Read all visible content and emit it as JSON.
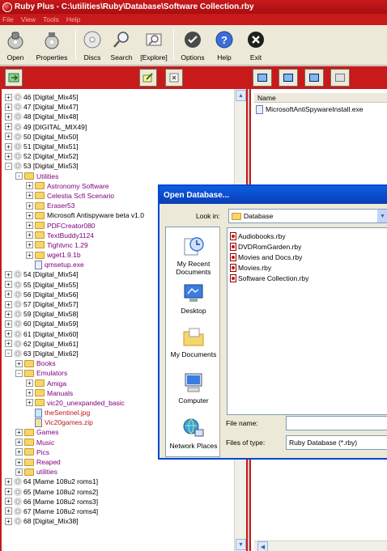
{
  "window": {
    "title": "Ruby Plus - C:\\utilities\\Ruby\\Database\\Software Collection.rby"
  },
  "menu": [
    "File",
    "View",
    "Tools",
    "Help"
  ],
  "toolbar": {
    "buttons": [
      {
        "label": "Open",
        "icon": "open-disc-icon"
      },
      {
        "label": "Properties",
        "icon": "properties-icon"
      },
      {
        "label": "Discs",
        "icon": "disc-icon"
      },
      {
        "label": "Search",
        "icon": "search-icon"
      },
      {
        "label": "[Explore]",
        "icon": "explore-icon"
      },
      {
        "label": "Options",
        "icon": "options-check-icon"
      },
      {
        "label": "Help",
        "icon": "help-icon"
      },
      {
        "label": "Exit",
        "icon": "exit-icon"
      }
    ]
  },
  "tree": [
    {
      "level": 0,
      "expander": "+",
      "icon": "disc",
      "label": "46 [Digital_Mix45]",
      "color": "default"
    },
    {
      "level": 0,
      "expander": "+",
      "icon": "disc",
      "label": "47 [Digital_Mix47]",
      "color": "default"
    },
    {
      "level": 0,
      "expander": "+",
      "icon": "disc",
      "label": "48 [Digital_Mix48]",
      "color": "default"
    },
    {
      "level": 0,
      "expander": "+",
      "icon": "disc",
      "label": "49 [DIGITAL_MIX49]",
      "color": "default"
    },
    {
      "level": 0,
      "expander": "+",
      "icon": "disc",
      "label": "50 [Digital_Mix50]",
      "color": "default"
    },
    {
      "level": 0,
      "expander": "+",
      "icon": "disc",
      "label": "51 [Digital_Mix51]",
      "color": "default"
    },
    {
      "level": 0,
      "expander": "+",
      "icon": "disc",
      "label": "52 [Digital_Mix52]",
      "color": "default"
    },
    {
      "level": 0,
      "expander": "-",
      "icon": "disc",
      "label": "53 [Digital_Mix53]",
      "color": "default"
    },
    {
      "level": 1,
      "expander": "-",
      "icon": "folder",
      "label": "Utilities",
      "color": "purple"
    },
    {
      "level": 2,
      "expander": "+",
      "icon": "folder",
      "label": "Astronomy Software",
      "color": "purple"
    },
    {
      "level": 2,
      "expander": "+",
      "icon": "folder",
      "label": "Celestia Scfi Scenario",
      "color": "purple"
    },
    {
      "level": 2,
      "expander": "+",
      "icon": "folder",
      "label": "Eraser53",
      "color": "purple"
    },
    {
      "level": 2,
      "expander": "+",
      "icon": "folder",
      "label": "Microsoft Antispyware beta v1.0",
      "color": "default"
    },
    {
      "level": 2,
      "expander": "+",
      "icon": "folder",
      "label": "PDFCreator080",
      "color": "purple"
    },
    {
      "level": 2,
      "expander": "+",
      "icon": "folder",
      "label": "TextBuddy1124",
      "color": "purple"
    },
    {
      "level": 2,
      "expander": "+",
      "icon": "folder",
      "label": "Tightvnc 1.29",
      "color": "purple"
    },
    {
      "level": 2,
      "expander": "+",
      "icon": "folder",
      "label": "wget1.9.1b",
      "color": "purple"
    },
    {
      "level": 2,
      "expander": "",
      "icon": "exe",
      "label": "qmsetup.exe",
      "color": "purple"
    },
    {
      "level": 0,
      "expander": "+",
      "icon": "disc",
      "label": "54 [Digital_Mix54]",
      "color": "default"
    },
    {
      "level": 0,
      "expander": "+",
      "icon": "disc",
      "label": "55 [Digital_Mix55]",
      "color": "default"
    },
    {
      "level": 0,
      "expander": "+",
      "icon": "disc",
      "label": "56 [Digital_Mix56]",
      "color": "default"
    },
    {
      "level": 0,
      "expander": "+",
      "icon": "disc",
      "label": "57 [Digital_Mix57]",
      "color": "default"
    },
    {
      "level": 0,
      "expander": "+",
      "icon": "disc",
      "label": "59 [Digital_Mix58]",
      "color": "default"
    },
    {
      "level": 0,
      "expander": "+",
      "icon": "disc",
      "label": "60 [Digital_Mix59]",
      "color": "default"
    },
    {
      "level": 0,
      "expander": "+",
      "icon": "disc",
      "label": "61 [Digital_Mix60]",
      "color": "default"
    },
    {
      "level": 0,
      "expander": "+",
      "icon": "disc",
      "label": "62 [Digital_Mix61]",
      "color": "default"
    },
    {
      "level": 0,
      "expander": "-",
      "icon": "disc",
      "label": "63 [Digital_Mix62]",
      "color": "default"
    },
    {
      "level": 1,
      "expander": "+",
      "icon": "folder",
      "label": "Books",
      "color": "purple"
    },
    {
      "level": 1,
      "expander": "-",
      "icon": "folder",
      "label": "Emulators",
      "color": "purple"
    },
    {
      "level": 2,
      "expander": "+",
      "icon": "folder",
      "label": "Amiga",
      "color": "purple"
    },
    {
      "level": 2,
      "expander": "+",
      "icon": "folder",
      "label": "Manuals",
      "color": "purple"
    },
    {
      "level": 2,
      "expander": "+",
      "icon": "folder",
      "label": "vic20_unexpanded_basic",
      "color": "purple"
    },
    {
      "level": 2,
      "expander": "",
      "icon": "image",
      "label": "theSentinel.jpg",
      "color": "red"
    },
    {
      "level": 2,
      "expander": "",
      "icon": "zip",
      "label": "Vic20games.zip",
      "color": "red"
    },
    {
      "level": 1,
      "expander": "+",
      "icon": "folder",
      "label": "Games",
      "color": "purple"
    },
    {
      "level": 1,
      "expander": "+",
      "icon": "folder",
      "label": "Music",
      "color": "purple"
    },
    {
      "level": 1,
      "expander": "+",
      "icon": "folder",
      "label": "Pics",
      "color": "purple"
    },
    {
      "level": 1,
      "expander": "+",
      "icon": "folder",
      "label": "Reaped",
      "color": "purple"
    },
    {
      "level": 1,
      "expander": "+",
      "icon": "folder",
      "label": "utilities",
      "color": "purple"
    },
    {
      "level": 0,
      "expander": "+",
      "icon": "disc",
      "label": "64 [Mame 108u2 roms1]",
      "color": "default"
    },
    {
      "level": 0,
      "expander": "+",
      "icon": "disc",
      "label": "65 [Mame 108u2 roms2]",
      "color": "default"
    },
    {
      "level": 0,
      "expander": "+",
      "icon": "disc",
      "label": "66 [Mame 108u2 roms3]",
      "color": "default"
    },
    {
      "level": 0,
      "expander": "+",
      "icon": "disc",
      "label": "67 [Mame 108u2 roms4]",
      "color": "default"
    },
    {
      "level": 0,
      "expander": "+",
      "icon": "disc",
      "label": "68 [Digital_Mix38]",
      "color": "default"
    }
  ],
  "right_pane": {
    "column_header": "Name",
    "items": [
      "MicrosoftAntiSpywareInstall.exe"
    ]
  },
  "dialog": {
    "title": "Open Database...",
    "look_in_label": "Look in:",
    "look_in_value": "Database",
    "places": [
      {
        "label": "My Recent Documents",
        "icon": "recent-documents-icon"
      },
      {
        "label": "Desktop",
        "icon": "desktop-icon"
      },
      {
        "label": "My Documents",
        "icon": "my-documents-icon"
      },
      {
        "label": "Computer",
        "icon": "computer-icon"
      },
      {
        "label": "Network Places",
        "icon": "network-places-icon"
      }
    ],
    "files": [
      "Audiobooks.rby",
      "DVDRomGarden.rby",
      "Movies and Docs.rby",
      "Movies.rby",
      "Software Collection.rby"
    ],
    "file_name_label": "File name:",
    "file_name_value": "",
    "file_type_label": "Files of type:",
    "file_type_value": "Ruby Database (*.rby)"
  },
  "colors": {
    "brand_red": "#c8191b",
    "folder_label": "#800080",
    "file_label": "#c01818",
    "dialog_title": "#0b49c8"
  }
}
